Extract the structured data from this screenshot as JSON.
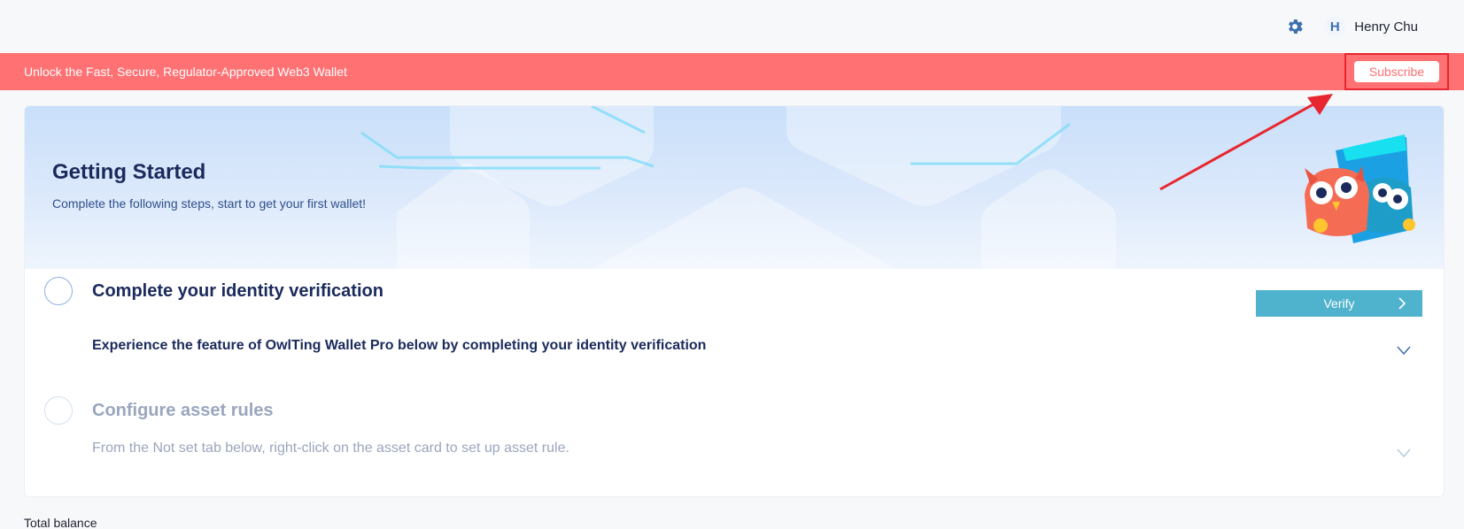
{
  "header": {
    "settings_icon": "gear-icon",
    "avatar_initial": "H",
    "user_name": "Henry Chu"
  },
  "promo": {
    "text": "Unlock the Fast, Secure, Regulator-Approved Web3 Wallet",
    "subscribe_label": "Subscribe",
    "background": "#ff7173"
  },
  "getting_started": {
    "title": "Getting Started",
    "subtitle": "Complete the following steps, start to get your first wallet!",
    "illustration": "owls-wallet-illustration",
    "steps": [
      {
        "title": "Complete your identity verification",
        "description": "Experience the feature of OwlTing Wallet Pro below by completing your identity verification",
        "action_label": "Verify",
        "active": true
      },
      {
        "title": "Configure asset rules",
        "description": "From the Not set tab below, right-click on the asset card to set up asset rule.",
        "active": false
      }
    ]
  },
  "balance": {
    "label": "Total balance"
  },
  "colors": {
    "accent": "#4fb3cd",
    "title": "#1b2a5c",
    "muted": "#9aa6bd",
    "annotation": "#e8262f"
  }
}
